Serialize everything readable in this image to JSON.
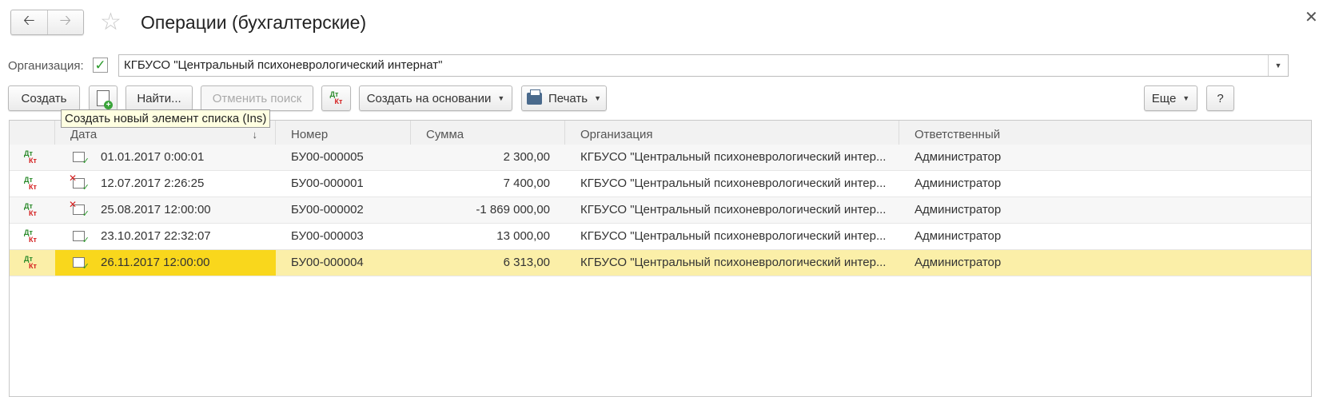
{
  "header": {
    "title": "Операции (бухгалтерские)",
    "back_icon": "arrow-left-icon",
    "forward_icon": "arrow-right-icon",
    "favorite_icon": "star-icon",
    "close_icon": "close-icon"
  },
  "org": {
    "label": "Организация:",
    "checked": true,
    "value": "КГБУСО \"Центральный психоневрологический интернат\""
  },
  "toolbar": {
    "create": "Создать",
    "find": "Найти...",
    "cancel_search": "Отменить поиск",
    "create_based": "Создать на основании",
    "print": "Печать",
    "more": "Еще",
    "help": "?",
    "dt": "Дт",
    "kt": "Кт"
  },
  "tooltip": "Создать новый элемент списка (Ins)",
  "table": {
    "columns": [
      "Дата",
      "Номер",
      "Сумма",
      "Организация",
      "Ответственный"
    ],
    "rows": [
      {
        "date": "01.01.2017 0:00:01",
        "number": "БУ00-000005",
        "sum": "2 300,00",
        "org": "КГБУСО \"Центральный психоневрологический интер...",
        "resp": "Администратор",
        "status": "posted"
      },
      {
        "date": "12.07.2017 2:26:25",
        "number": "БУ00-000001",
        "sum": "7 400,00",
        "org": "КГБУСО \"Центральный психоневрологический интер...",
        "resp": "Администратор",
        "status": "deleted"
      },
      {
        "date": "25.08.2017 12:00:00",
        "number": "БУ00-000002",
        "sum": "-1 869 000,00",
        "org": "КГБУСО \"Центральный психоневрологический интер...",
        "resp": "Администратор",
        "status": "deleted"
      },
      {
        "date": "23.10.2017 22:32:07",
        "number": "БУ00-000003",
        "sum": "13 000,00",
        "org": "КГБУСО \"Центральный психоневрологический интер...",
        "resp": "Администратор",
        "status": "posted"
      },
      {
        "date": "26.11.2017 12:00:00",
        "number": "БУ00-000004",
        "sum": "6 313,00",
        "org": "КГБУСО \"Центральный психоневрологический интер...",
        "resp": "Администратор",
        "status": "posted",
        "selected": true
      }
    ]
  },
  "colors": {
    "selected_row": "#fbefa8",
    "selected_cell": "#f9d71c",
    "dt_green": "#2a8a2a",
    "kt_red": "#d42020"
  }
}
